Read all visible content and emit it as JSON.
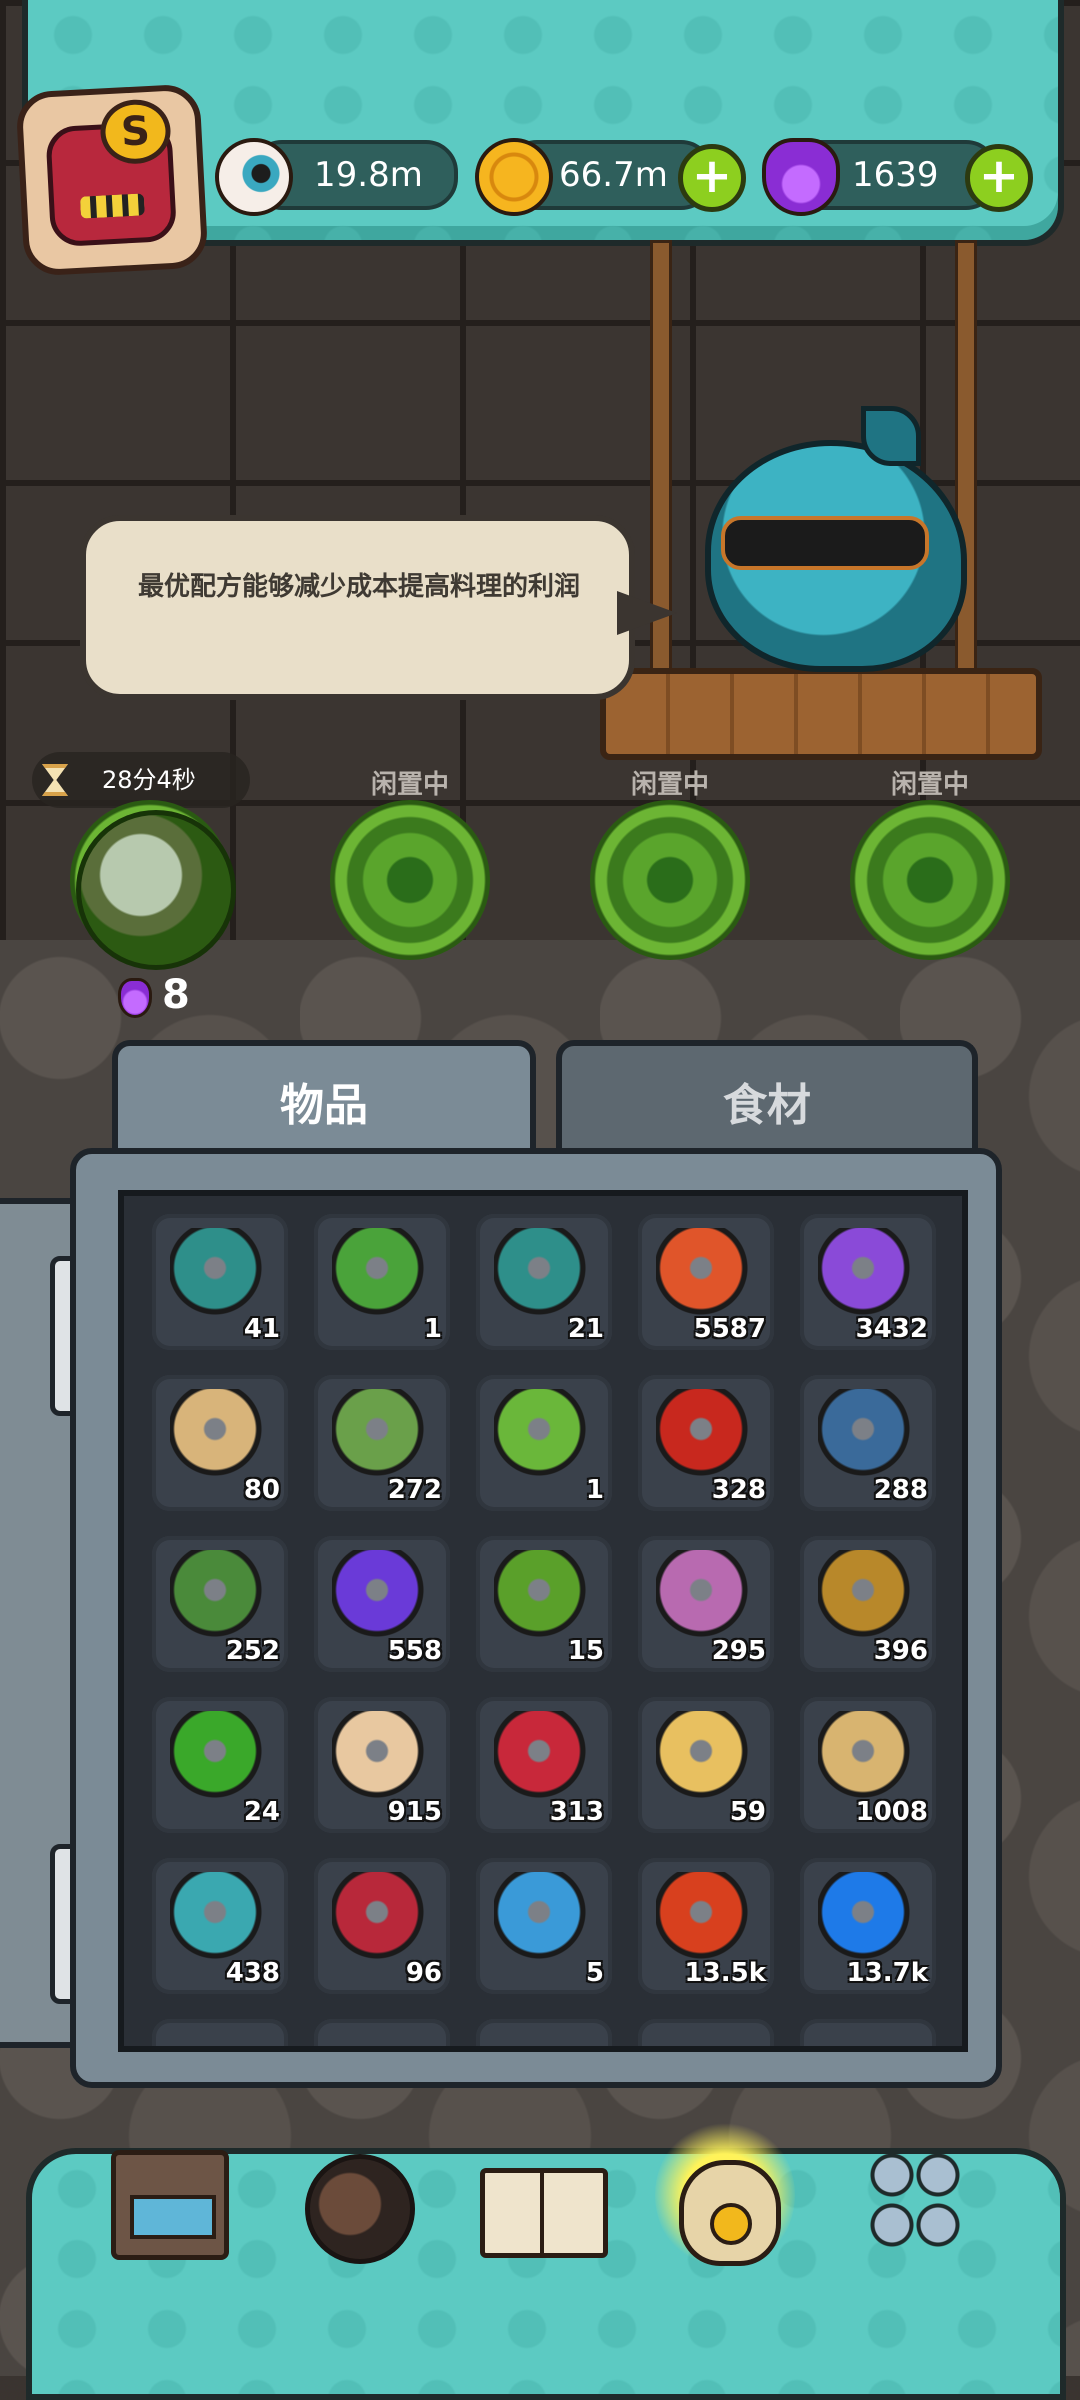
{
  "rank": {
    "letter": "S"
  },
  "resources": [
    {
      "name": "eyeballs",
      "icon": "eyeball-icon",
      "value": "19.8m"
    },
    {
      "name": "coins",
      "icon": "coin-icon",
      "value": "66.7m"
    },
    {
      "name": "potions",
      "icon": "potion-icon",
      "value": "1639"
    }
  ],
  "speech": {
    "text": "最优配方能够减少成本提高料理的利润"
  },
  "timer": {
    "text": "28分4秒"
  },
  "slots": [
    {
      "label": "",
      "state": "active"
    },
    {
      "label": "闲置中",
      "state": "idle"
    },
    {
      "label": "闲置中",
      "state": "idle"
    },
    {
      "label": "闲置中",
      "state": "idle"
    }
  ],
  "slot_reward": {
    "icon": "potion-icon",
    "count": "8"
  },
  "tabs": {
    "items": "物品",
    "ingredients": "食材"
  },
  "inventory": [
    {
      "icon": "teal-bottle-icon",
      "color": "#2e8f8a",
      "count": "41"
    },
    {
      "icon": "green-bottle-icon",
      "color": "#4aa33a",
      "count": "1"
    },
    {
      "icon": "teal-bottle-icon",
      "color": "#2e8f8a",
      "count": "21"
    },
    {
      "icon": "meat-bone-icon",
      "color": "#e0552a",
      "count": "5587"
    },
    {
      "icon": "purple-powder-icon",
      "color": "#8a4ad8",
      "count": "3432"
    },
    {
      "icon": "parchment-icon",
      "color": "#d8b47a",
      "count": "80"
    },
    {
      "icon": "monster-card-icon",
      "color": "#6aa04a",
      "count": "272"
    },
    {
      "icon": "green-gift-bag-icon",
      "color": "#6ab73a",
      "count": "1"
    },
    {
      "icon": "oil-barrel-icon",
      "color": "#c8281e",
      "count": "328"
    },
    {
      "icon": "blue-card-icon",
      "color": "#3a6a9a",
      "count": "288"
    },
    {
      "icon": "potion-card-icon",
      "color": "#4a8a3a",
      "count": "252"
    },
    {
      "icon": "crystal-cluster-icon",
      "color": "#6a3ad8",
      "count": "558"
    },
    {
      "icon": "green-rock-icon",
      "color": "#5aa02a",
      "count": "15"
    },
    {
      "icon": "scroll-map-icon",
      "color": "#b86ab0",
      "count": "295"
    },
    {
      "icon": "treasure-card-icon",
      "color": "#b8882a",
      "count": "396"
    },
    {
      "icon": "clover-icon",
      "color": "#3aa82a",
      "count": "24"
    },
    {
      "icon": "rabbit-cake-icon",
      "color": "#e8c8a0",
      "count": "915"
    },
    {
      "icon": "santa-hat-icon",
      "color": "#c8283a",
      "count": "313"
    },
    {
      "icon": "coin-bread-icon",
      "color": "#e8c060",
      "count": "59"
    },
    {
      "icon": "smiling-sack-icon",
      "color": "#d8b470",
      "count": "1008"
    },
    {
      "icon": "dark-cookie-icon",
      "color": "#3aa8b0",
      "count": "438"
    },
    {
      "icon": "christmas-stocking-icon",
      "color": "#b8283a",
      "count": "96"
    },
    {
      "icon": "puzzle-monster-icon",
      "color": "#3a9ad8",
      "count": "5"
    },
    {
      "icon": "red-triangle-gem-icon",
      "color": "#d8401e",
      "count": "13.5k"
    },
    {
      "icon": "blue-square-gem-icon",
      "color": "#1e7ae8",
      "count": "13.7k"
    }
  ],
  "nav": [
    {
      "name": "shop",
      "icon": "restaurant-icon"
    },
    {
      "name": "monster",
      "icon": "monster-icon"
    },
    {
      "name": "recipe-book",
      "icon": "book-icon"
    },
    {
      "name": "bag",
      "icon": "bag-icon",
      "active": true
    },
    {
      "name": "more",
      "icon": "grid-icon"
    }
  ],
  "colors": {
    "accent": "#5ccac2",
    "panel": "#7b8b96",
    "plus": "#8dcf1f"
  }
}
